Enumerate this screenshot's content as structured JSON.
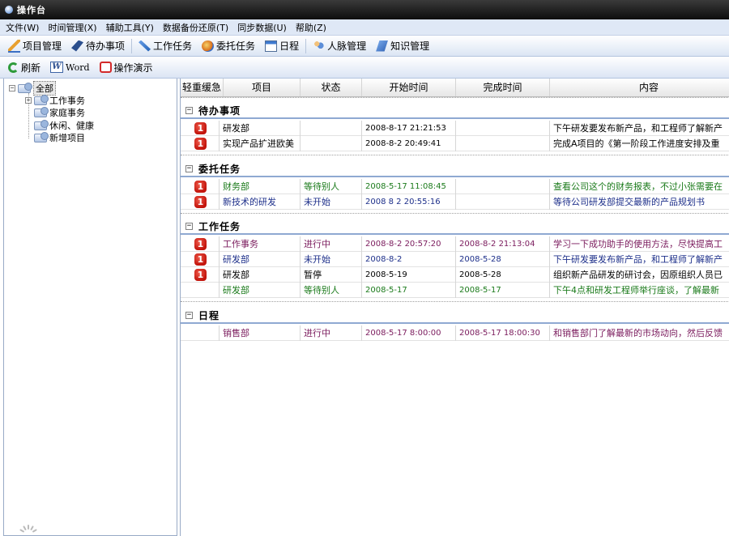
{
  "window": {
    "title": "操作台"
  },
  "menu": [
    "文件(W)",
    "时间管理(X)",
    "辅助工具(Y)",
    "数据备份还原(T)",
    "同步数据(U)",
    "帮助(Z)"
  ],
  "toolbar_main": {
    "project": "项目管理",
    "todo": "待办事项",
    "task": "工作任务",
    "entrust": "委托任务",
    "schedule": "日程",
    "people": "人脉管理",
    "knowledge": "知识管理"
  },
  "toolbar_secondary": {
    "refresh": "刷新",
    "word": "Word",
    "demo": "操作演示"
  },
  "tree": {
    "root": "全部",
    "children": [
      "工作事务",
      "家庭事务",
      "休闲、健康",
      "新增项目"
    ]
  },
  "grid": {
    "columns": [
      "轻重缓急",
      "项目",
      "状态",
      "开始时间",
      "完成时间",
      "内容"
    ],
    "groups": [
      {
        "label": "待办事项",
        "rows": [
          {
            "priority": "1",
            "project": "研发部",
            "status": "",
            "start": "2008-8-17 21:21:53",
            "end": "",
            "content": "下午研发要发布新产品，和工程师了解新产",
            "color": "black"
          },
          {
            "priority": "1",
            "project": "实现产品扩进欧美",
            "status": "",
            "start": "2008-8-2 20:49:41",
            "end": "",
            "content": "完成A项目的《第一阶段工作进度安排及重",
            "color": "black"
          }
        ]
      },
      {
        "label": "委托任务",
        "rows": [
          {
            "priority": "1",
            "project": "财务部",
            "status": "等待别人",
            "start": "2008-5-17 11:08:45",
            "end": "",
            "content": "查看公司这个的财务报表，不过小张需要在",
            "color": "green"
          },
          {
            "priority": "1",
            "project": "新技术的研发",
            "status": "未开始",
            "start": "2008 8 2 20:55:16",
            "end": "",
            "content": "等待公司研发部提交最新的产品规划书",
            "color": "blue"
          }
        ]
      },
      {
        "label": "工作任务",
        "rows": [
          {
            "priority": "1",
            "project": "工作事务",
            "status": "进行中",
            "start": "2008-8-2 20:57:20",
            "end": "2008-8-2 21:13:04",
            "content": "学习一下成功助手的使用方法，尽快提高工",
            "color": "purple"
          },
          {
            "priority": "1",
            "project": "研发部",
            "status": "未开始",
            "start": "2008-8-2",
            "end": "2008-5-28",
            "content": "下午研发要发布新产品，和工程师了解新产",
            "color": "blue"
          },
          {
            "priority": "1",
            "project": "研发部",
            "status": "暂停",
            "start": "2008-5-19",
            "end": "2008-5-28",
            "content": "组织新产品研发的研讨会，因原组织人员已",
            "color": "black"
          },
          {
            "priority": "",
            "project": "研发部",
            "status": "等待别人",
            "start": "2008-5-17",
            "end": "2008-5-17",
            "content": "下午4点和研发工程师举行座谈，了解最新",
            "color": "green"
          }
        ]
      },
      {
        "label": "日程",
        "rows": [
          {
            "priority": "",
            "project": "销售部",
            "status": "进行中",
            "start": "2008-5-17 8:00:00",
            "end": "2008-5-17 18:00:30",
            "content": "和销售部门了解最新的市场动向，然后反馈",
            "color": "purple"
          }
        ]
      }
    ]
  }
}
